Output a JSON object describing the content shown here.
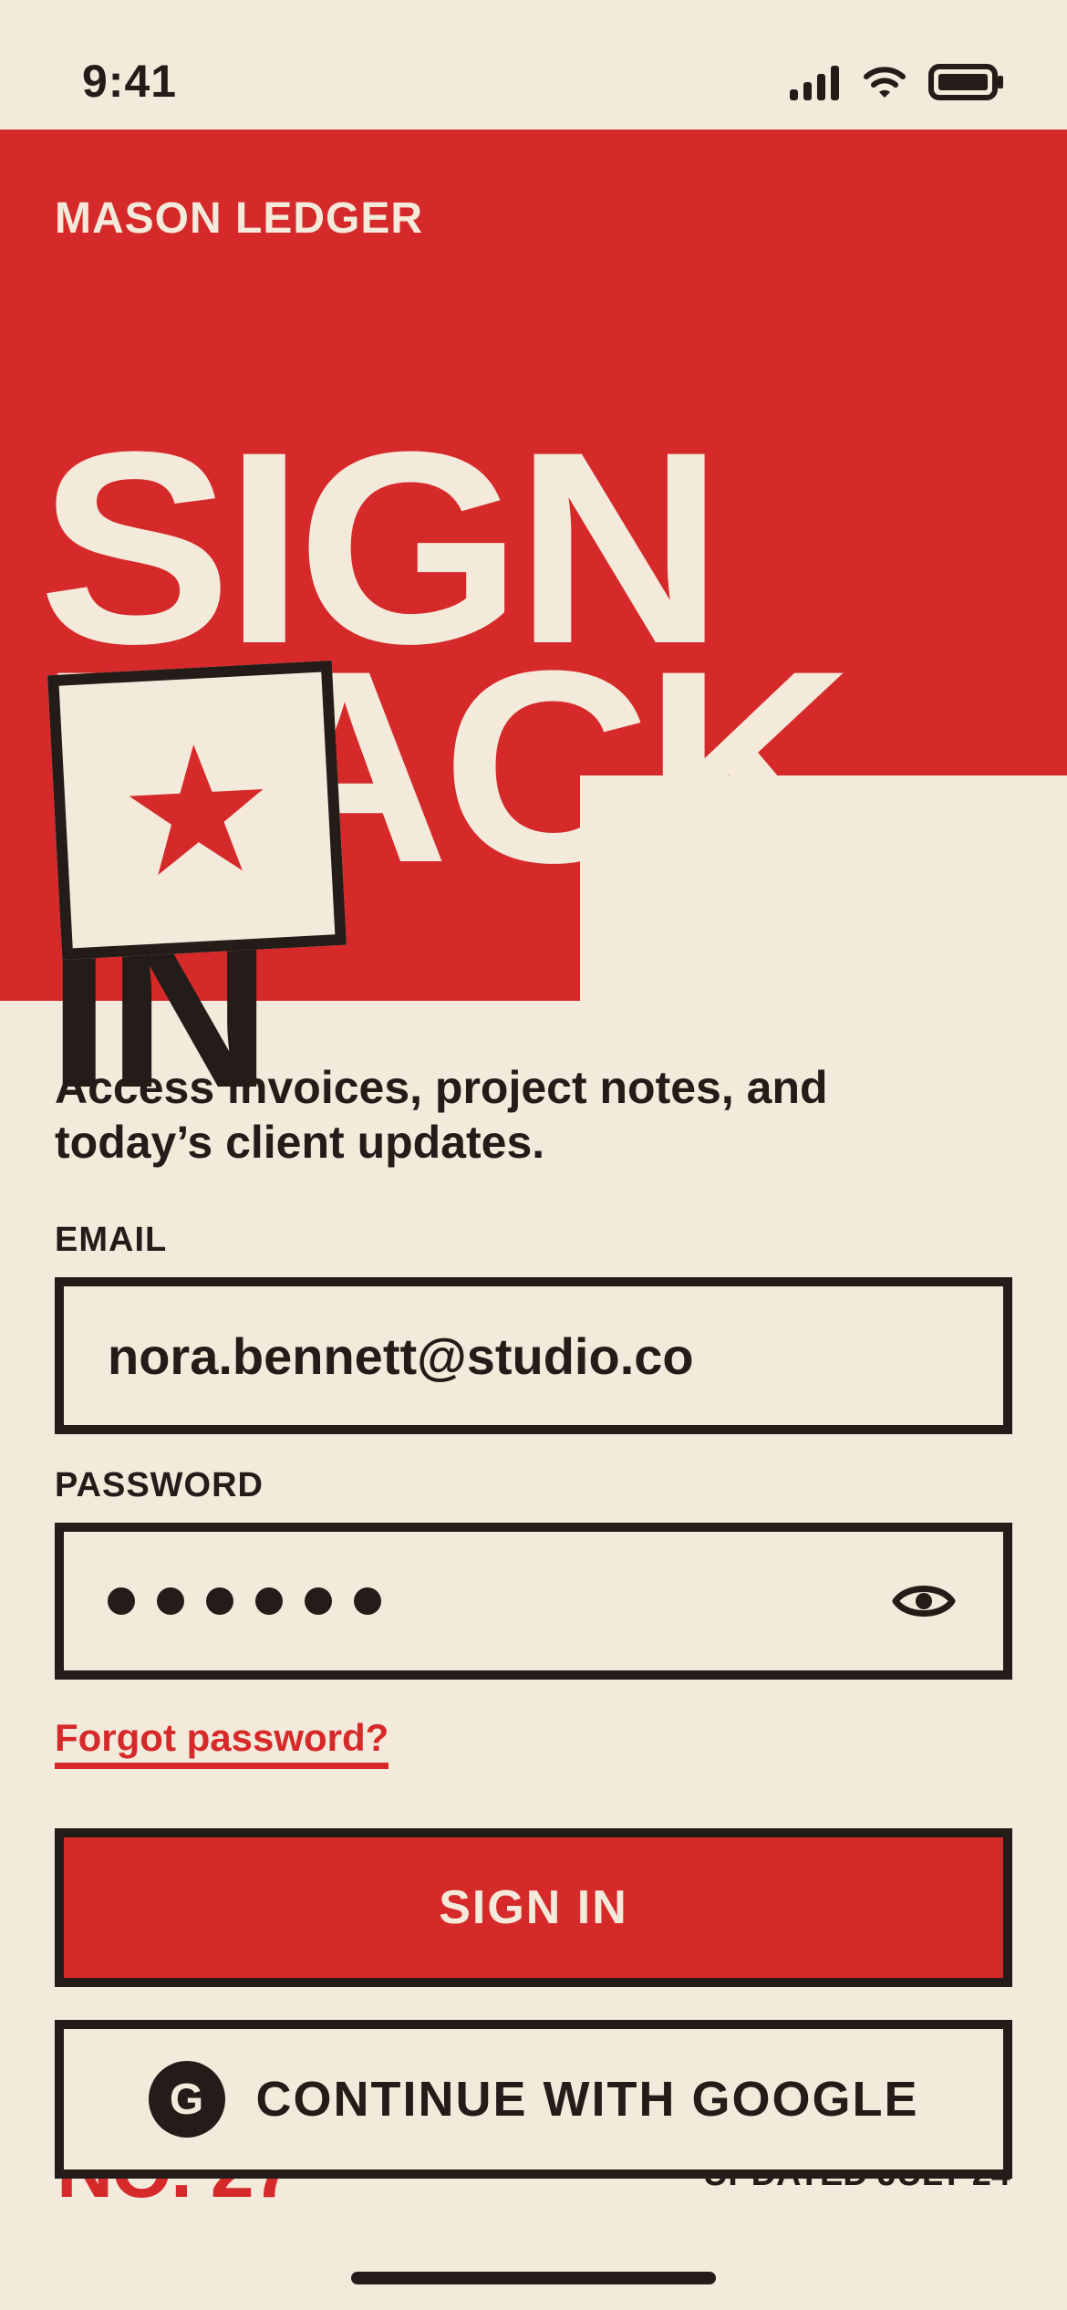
{
  "status_bar": {
    "time": "9:41",
    "icons": [
      "cellular-signal-icon",
      "wifi-icon",
      "battery-icon"
    ]
  },
  "brand": {
    "name": "MASON LEDGER"
  },
  "hero": {
    "line1": "SIGN",
    "line2": "BACK",
    "line3": "IN"
  },
  "stamp": {
    "icon": "star-icon"
  },
  "subtitle": "Access invoices, project notes, and today’s client updates.",
  "form": {
    "email_label": "EMAIL",
    "email_value": "nora.bennett@studio.co",
    "password_label": "PASSWORD",
    "password_length": 6,
    "password_toggle_icon": "eye-icon",
    "forgot_link": "Forgot password?"
  },
  "buttons": {
    "sign_in": "SIGN IN",
    "google": "CONTINUE WITH GOOGLE",
    "google_icon_letter": "G"
  },
  "footer": {
    "left_text": "NO. 27",
    "right_text": "UPDATED JULY 24"
  },
  "colors": {
    "accent_red": "#D6292A",
    "background_cream": "#F3EADB",
    "ink": "#231C18"
  }
}
